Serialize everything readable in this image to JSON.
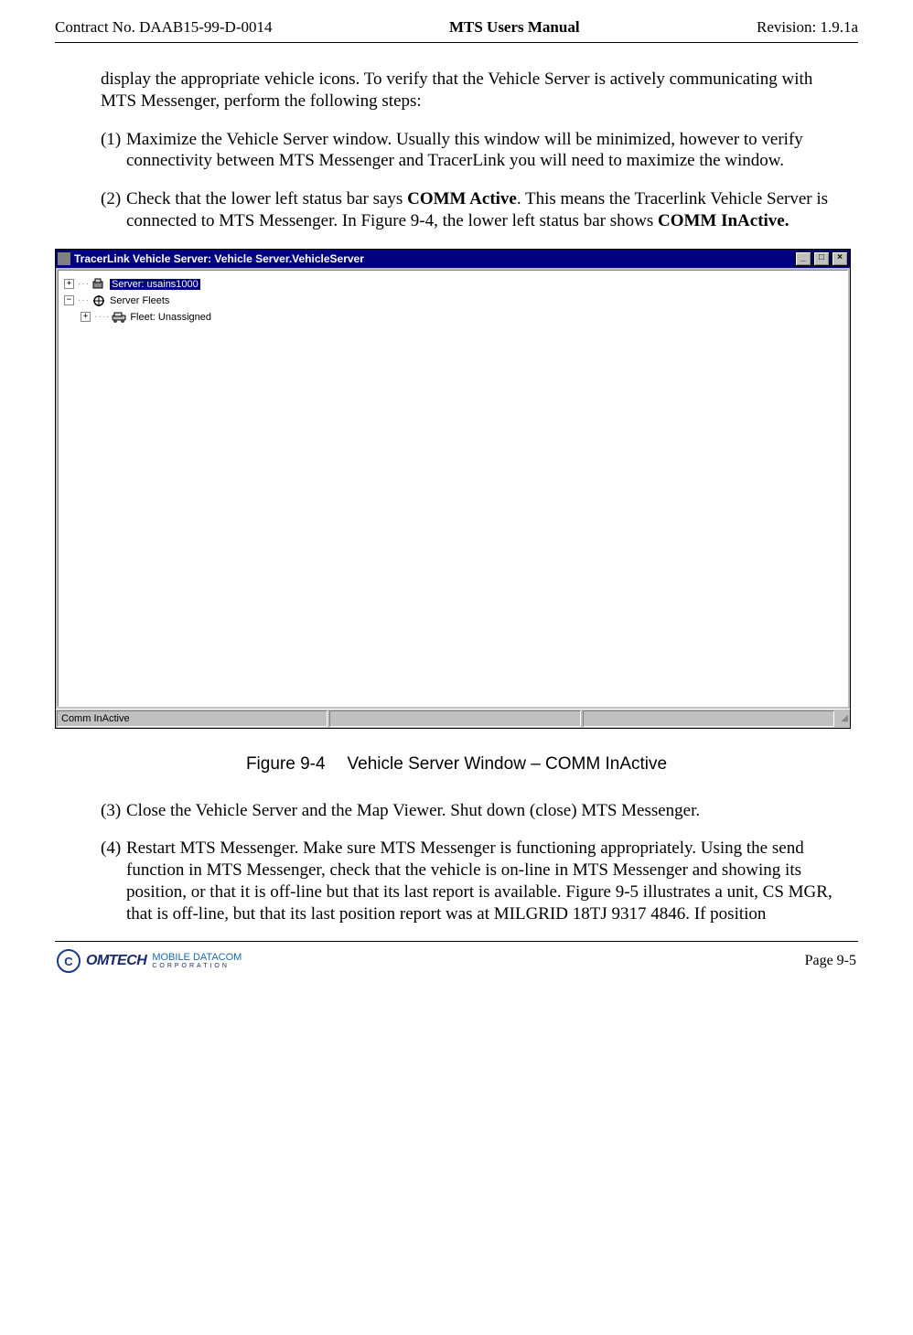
{
  "header": {
    "left": "Contract No. DAAB15-99-D-0014",
    "center": "MTS Users Manual",
    "right": "Revision:  1.9.1a"
  },
  "body": {
    "intro": "display the appropriate vehicle icons.  To verify that the Vehicle Server is actively communicating with MTS Messenger, perform the following steps:",
    "items": [
      {
        "num": "(1)",
        "text": "Maximize the Vehicle Server window. Usually this window will be minimized, however to verify connectivity between MTS Messenger and TracerLink you will need to maximize the window."
      },
      {
        "num": "(2)",
        "text_parts": [
          {
            "t": "Check that the lower left status bar says ",
            "b": false
          },
          {
            "t": "COMM Active",
            "b": true
          },
          {
            "t": ".  This means the Tracerlink Vehicle Server is connected to MTS Messenger.  In Figure 9-4, the lower left status bar shows ",
            "b": false
          },
          {
            "t": "COMM InActive.",
            "b": true
          }
        ]
      },
      {
        "num": "(3)",
        "text": "Close the Vehicle Server and the Map Viewer.  Shut down (close) MTS Messenger."
      },
      {
        "num": "(4)",
        "text": "Restart MTS Messenger.  Make sure MTS Messenger is functioning appropriately.  Using the send function in MTS Messenger, check that the vehicle is on-line in MTS Messenger and showing its position, or that it is off-line but that its last report is available.  Figure 9-5 illustrates a unit, CS MGR, that is off-line, but that its last position report was at MILGRID 18TJ 9317 4846.  If position"
      }
    ]
  },
  "app": {
    "title": "TracerLink Vehicle Server:   Vehicle Server.VehicleServer",
    "win_buttons": {
      "min": "_",
      "max": "□",
      "close": "×"
    },
    "tree": {
      "root_expander": "+",
      "root_label": "Server: usains1000",
      "child_expander": "−",
      "child_label": "Server Fleets",
      "leaf_expander": "+",
      "leaf_label": "Fleet: Unassigned"
    },
    "status": {
      "cell1": "Comm InActive",
      "cell2": "",
      "cell3": ""
    }
  },
  "caption": {
    "fig": "Figure 9-4",
    "title": "Vehicle Server Window – COMM InActive"
  },
  "footer": {
    "logo1": "OMTECH",
    "logo2": "MOBILE DATACOM",
    "logo2sub": "CORPORATION",
    "page": "Page 9-5"
  }
}
